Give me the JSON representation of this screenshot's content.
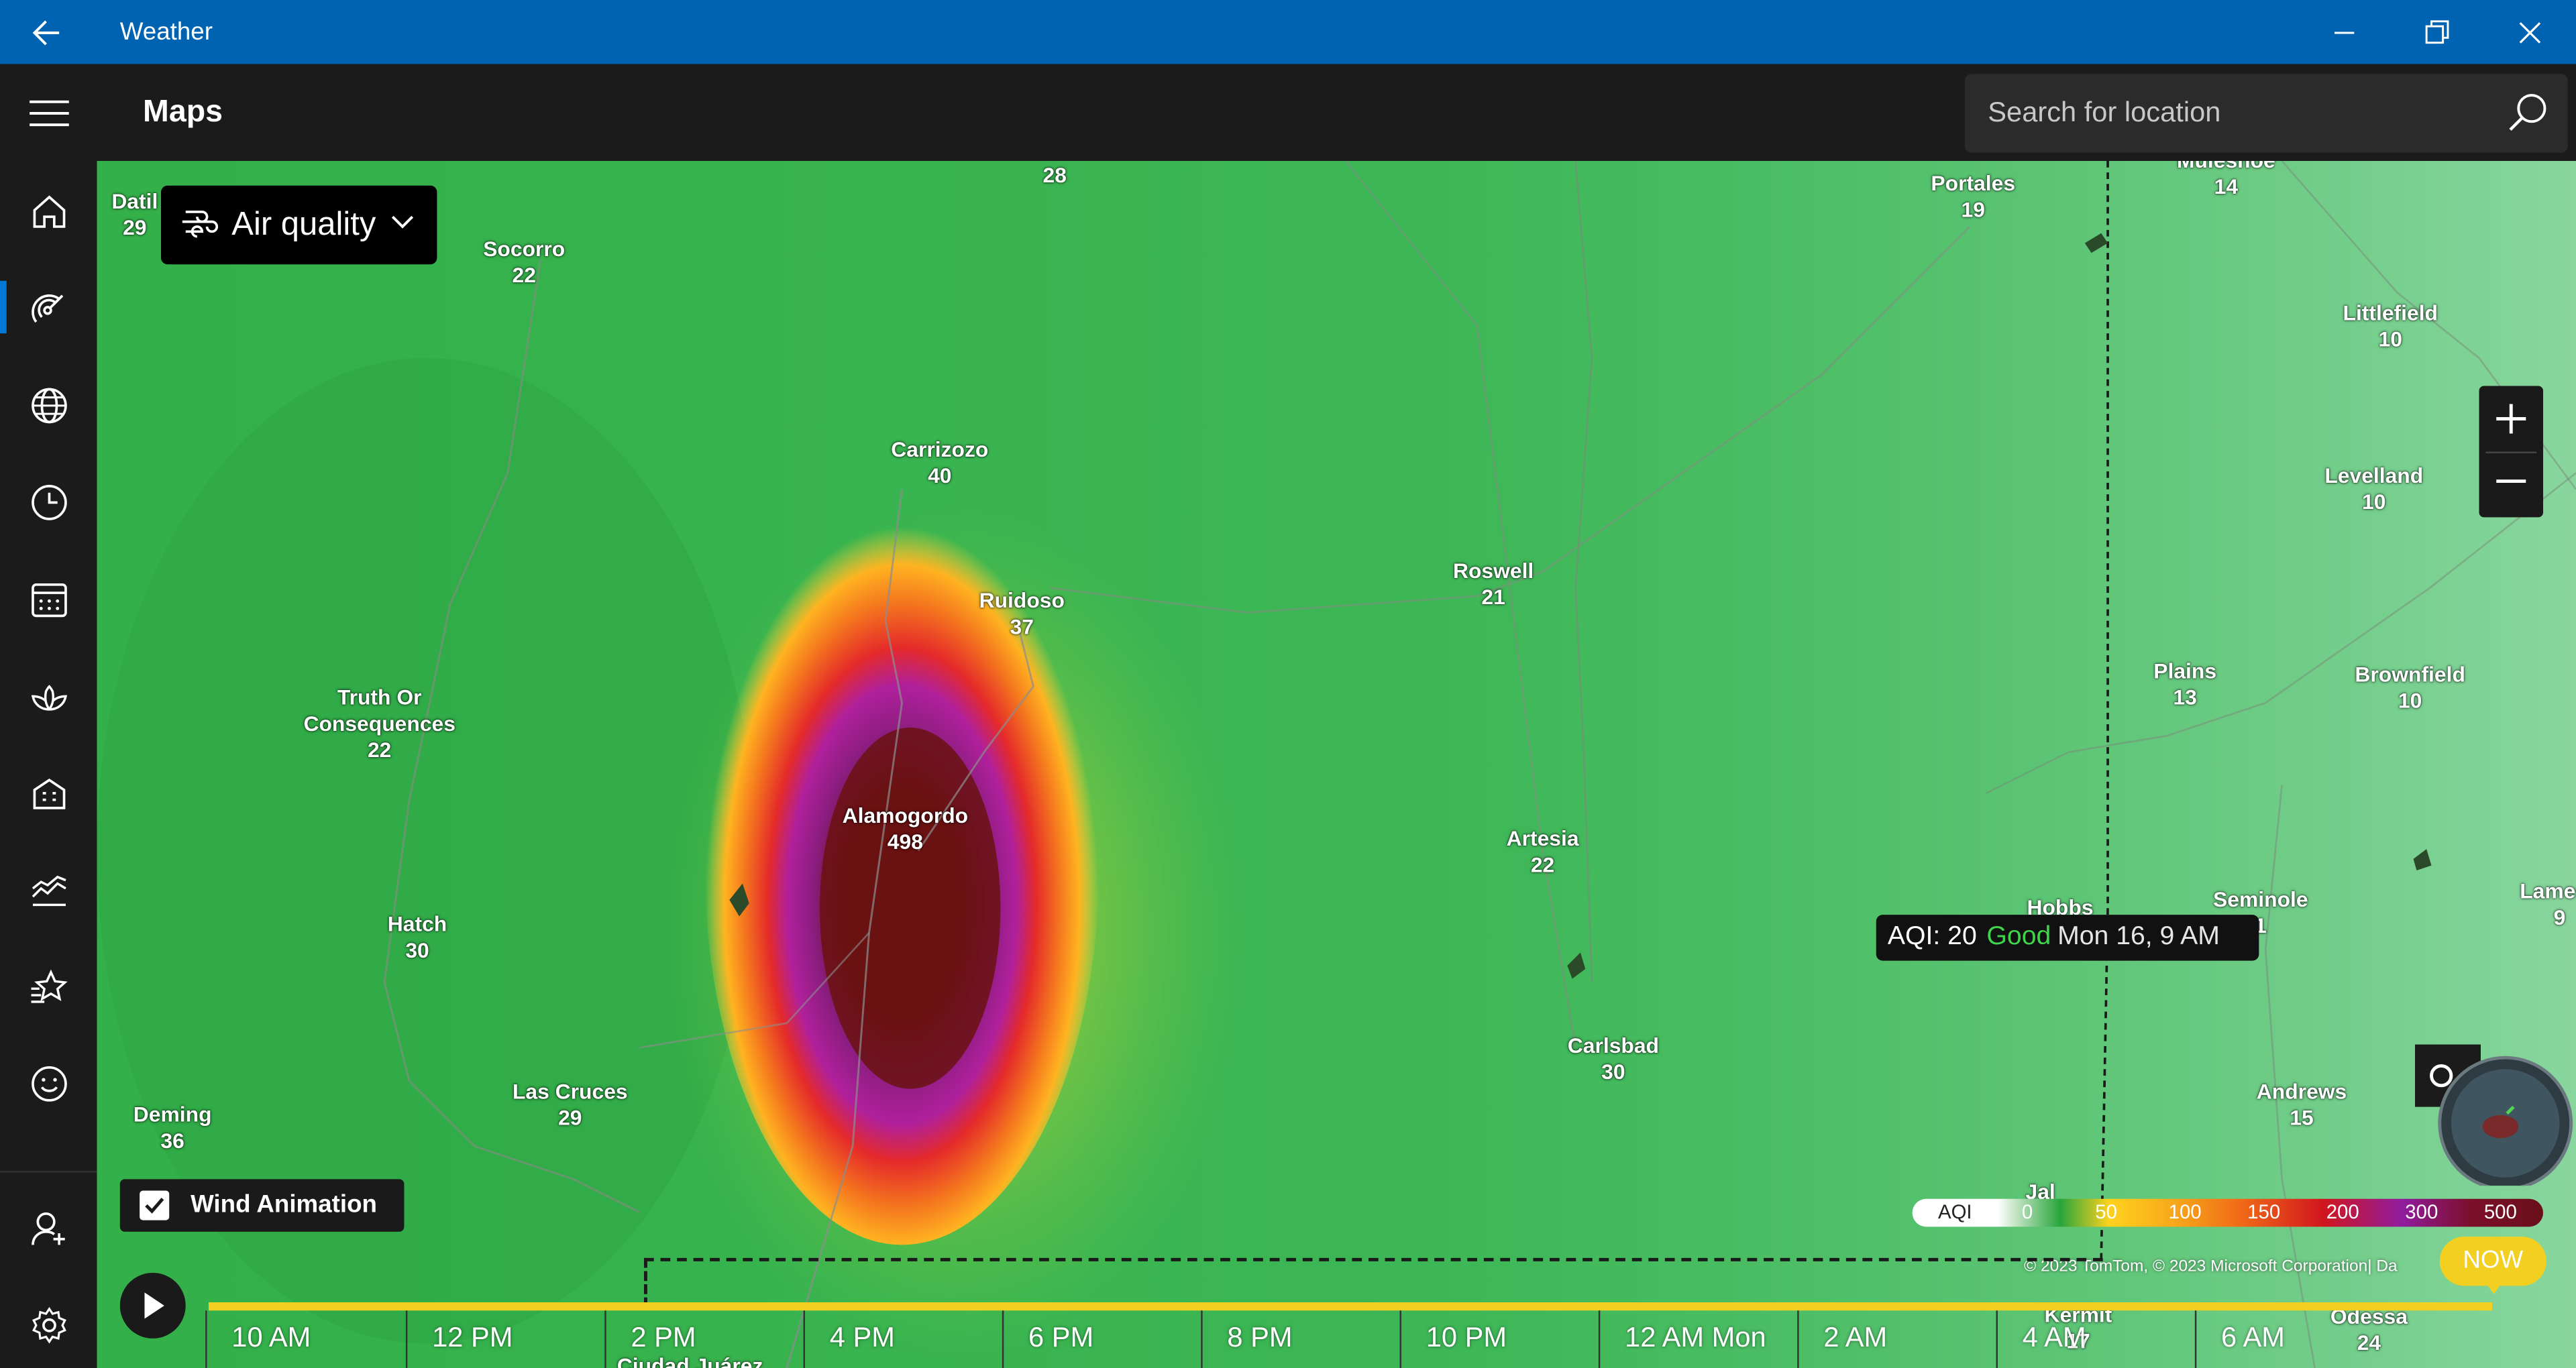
{
  "app": {
    "title": "Weather"
  },
  "header": {
    "page_title": "Maps",
    "search_placeholder": "Search for location"
  },
  "rail": {
    "items": [
      {
        "name": "home-icon"
      },
      {
        "name": "maps-radar-icon",
        "active": true
      },
      {
        "name": "globe-icon"
      },
      {
        "name": "clock-icon"
      },
      {
        "name": "calendar-icon"
      },
      {
        "name": "lotus-icon"
      },
      {
        "name": "building-icon"
      },
      {
        "name": "chart-icon"
      },
      {
        "name": "favorites-icon"
      },
      {
        "name": "smiley-icon"
      },
      {
        "name": "account-add-icon"
      },
      {
        "name": "settings-icon"
      }
    ],
    "accent": "#0078d4"
  },
  "map": {
    "layer_label": "Air quality",
    "cities": [
      {
        "name": "Datil",
        "aqi": "29"
      },
      {
        "name": "Socorro",
        "aqi": "22"
      },
      {
        "name": "",
        "aqi": "28"
      },
      {
        "name": "Portales",
        "aqi": "19"
      },
      {
        "name": "Muleshoe",
        "aqi": "14"
      },
      {
        "name": "Littlefield",
        "aqi": "10"
      },
      {
        "name": "Carrizozo",
        "aqi": "40"
      },
      {
        "name": "Levelland",
        "aqi": "10"
      },
      {
        "name": "Ruidoso",
        "aqi": "37"
      },
      {
        "name": "Roswell",
        "aqi": "21"
      },
      {
        "name": "Plains",
        "aqi": "13"
      },
      {
        "name": "Brownfield",
        "aqi": "10"
      },
      {
        "name": "Truth Or\nConsequences",
        "aqi": "22"
      },
      {
        "name": "Alamogordo",
        "aqi": "498"
      },
      {
        "name": "Artesia",
        "aqi": "22"
      },
      {
        "name": "Hobbs",
        "aqi": ""
      },
      {
        "name": "Seminole",
        "aqi": "1"
      },
      {
        "name": "Lamesa",
        "aqi": "9"
      },
      {
        "name": "Hatch",
        "aqi": "30"
      },
      {
        "name": "Carlsbad",
        "aqi": "30"
      },
      {
        "name": "Deming",
        "aqi": "36"
      },
      {
        "name": "Las Cruces",
        "aqi": "29"
      },
      {
        "name": "Andrews",
        "aqi": "15"
      },
      {
        "name": "Jal",
        "aqi": ""
      },
      {
        "name": "Kermit",
        "aqi": "17"
      },
      {
        "name": "Odessa",
        "aqi": "24"
      },
      {
        "name": "Ciudad Juárez",
        "aqi": ""
      }
    ],
    "tooltip": {
      "aqi": "AQI: 20",
      "level": "Good",
      "time": "Mon 16, 9 AM"
    },
    "legend": {
      "title": "AQI",
      "stops": [
        "0",
        "50",
        "100",
        "150",
        "200",
        "300",
        "500"
      ]
    },
    "attribution": "© 2023 TomTom, © 2023 Microsoft Corporation|  Da",
    "wind_animation": {
      "label": "Wind Animation",
      "checked": true
    }
  },
  "timeline": {
    "now_label": "NOW",
    "ticks": [
      "10 AM",
      "12 PM",
      "2 PM",
      "4 PM",
      "6 PM",
      "8 PM",
      "10 PM",
      "12 AM Mon",
      "2 AM",
      "4 AM",
      "6 AM"
    ]
  }
}
